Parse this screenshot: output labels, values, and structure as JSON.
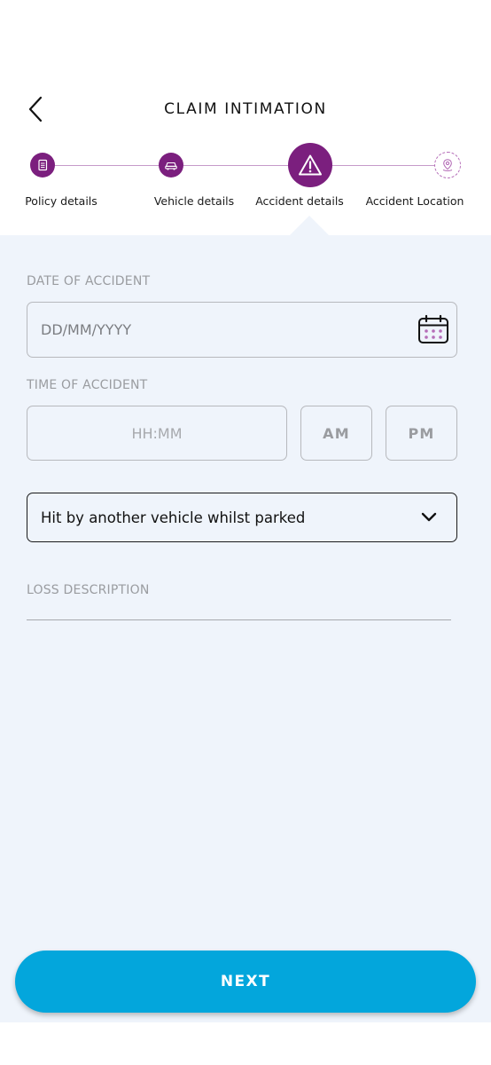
{
  "header": {
    "title": "CLAIM INTIMATION",
    "back_icon": "chevron-left-icon"
  },
  "stepper": {
    "steps": [
      {
        "label": "Policy details",
        "state": "done",
        "icon": "document-icon"
      },
      {
        "label": "Vehicle details",
        "state": "done",
        "icon": "car-icon"
      },
      {
        "label": "Accident details",
        "state": "active",
        "icon": "warning-icon"
      },
      {
        "label": "Accident Location",
        "state": "todo",
        "icon": "location-pin-icon"
      }
    ]
  },
  "form": {
    "date_label": "DATE OF ACCIDENT",
    "date_placeholder": "DD/MM/YYYY",
    "date_icon": "calendar-icon",
    "time_label": "TIME OF ACCIDENT",
    "time_placeholder": "HH:MM",
    "am_label": "AM",
    "pm_label": "PM",
    "incident_type_value": "Hit by another vehicle whilst parked",
    "incident_type_icon": "chevron-down-icon",
    "loss_label": "LOSS DESCRIPTION"
  },
  "footer": {
    "next_label": "NEXT"
  },
  "colors": {
    "brand_purple": "#7b1f7e",
    "primary_blue": "#03a6dc",
    "form_background": "#eff4fb"
  }
}
